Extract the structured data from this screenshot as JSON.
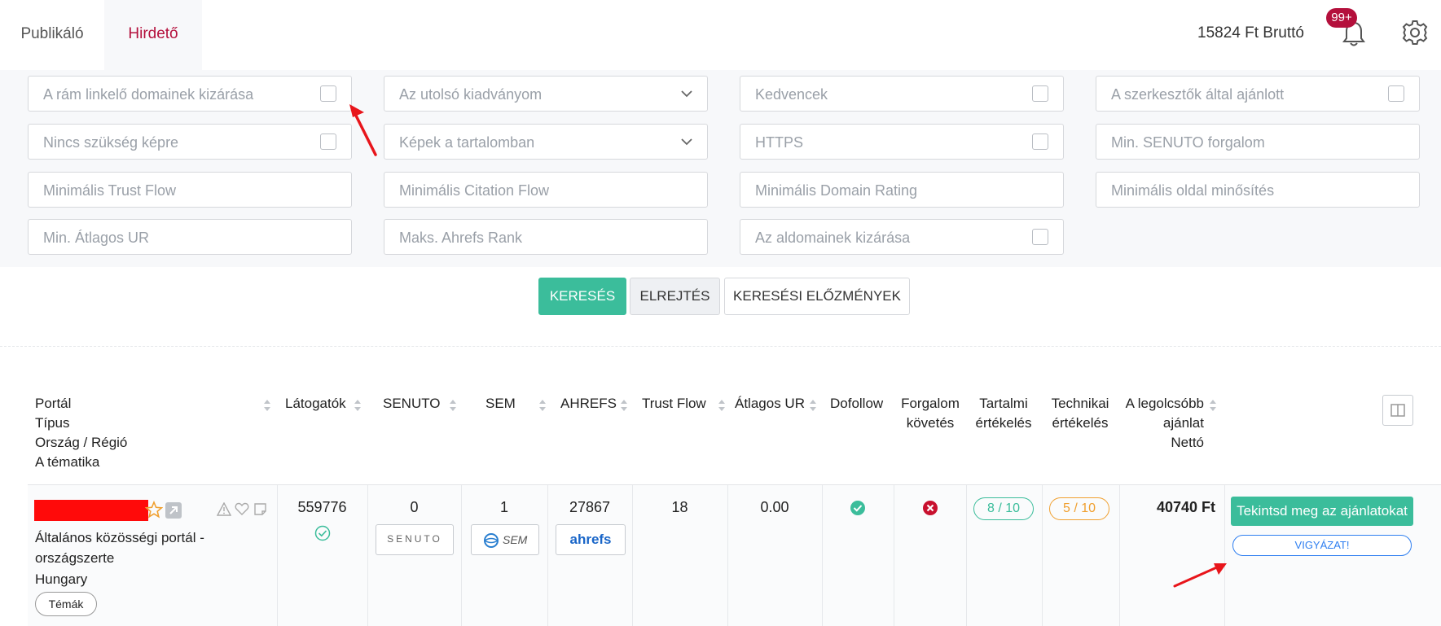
{
  "nav": {
    "tabs": [
      {
        "label": "Publikáló"
      },
      {
        "label": "Hirdető"
      }
    ],
    "balance": "15824 Ft Bruttó",
    "notifications_badge": "99+"
  },
  "filters": {
    "exclude_linking_domains": "A rám linkelő domainek kizárása",
    "last_publication": "Az utolsó kiadványom",
    "favorites": "Kedvencek",
    "editor_recommended": "A szerkesztők által ajánlott",
    "no_image_needed": "Nincs szükség képre",
    "images_in_content": "Képek a tartalomban",
    "https": "HTTPS",
    "min_senuto": "Min. SENUTO forgalom",
    "min_trust_flow": "Minimális Trust Flow",
    "min_citation_flow": "Minimális Citation Flow",
    "min_domain_rating": "Minimális Domain Rating",
    "min_page_rating": "Minimális oldal minősítés",
    "min_avg_ur": "Min. Átlagos UR",
    "max_ahrefs_rank": "Maks. Ahrefs Rank",
    "exclude_subdomains": "Az aldomainek kizárása"
  },
  "actions": {
    "search": "KERESÉS",
    "hide": "ELREJTÉS",
    "history": "KERESÉSI ELŐZMÉNYEK"
  },
  "table": {
    "headers": {
      "portal": "Portál",
      "type": "Típus",
      "country_region": "Ország / Régió",
      "topic": "A tématika",
      "visitors": "Látogatók",
      "senuto": "SENUTO",
      "sem": "SEM",
      "ahrefs": "AHREFS",
      "trust_flow": "Trust Flow",
      "avg_ur": "Átlagos UR",
      "dofollow": "Dofollow",
      "traffic_1": "Forgalom",
      "traffic_2": "követés",
      "content_1": "Tartalmi",
      "content_2": "értékelés",
      "tech_1": "Technikai",
      "tech_2": "értékelés",
      "price_1": "A legolcsóbb",
      "price_2": "ajánlat",
      "price_3": "Nettó"
    },
    "rows": [
      {
        "type_line1": "Általános közösségi portál -",
        "type_line2": "országszerte",
        "country": "Hungary",
        "topics_button": "Témák",
        "visitors": "559776",
        "senuto": "0",
        "senuto_logo": "SENUTO",
        "sem": "1",
        "sem_logo": "SEM",
        "ahrefs": "27867",
        "ahrefs_logo": "ahrefs",
        "trust_flow": "18",
        "avg_ur": "0.00",
        "content_rating": "8 / 10",
        "tech_rating": "5 / 10",
        "price": "40740 Ft",
        "offers_button": "Tekintsd meg az ajánlatokat",
        "warning_button": "VIGYÁZAT!"
      }
    ]
  },
  "colors": {
    "accent": "#b4103c",
    "primary_green": "#3bbd9b",
    "annotation_red": "#e8151b",
    "warning_blue": "#2f7ff0",
    "rating_green": "#3bbd9b",
    "rating_orange": "#f0a030"
  },
  "icons": [
    "bell-icon",
    "gear-icon",
    "checkbox",
    "chevron-down-icon",
    "sort-icon",
    "star-icon",
    "external-link-icon",
    "warning-icon",
    "heart-icon",
    "note-icon",
    "check-circle-icon",
    "x-circle-icon",
    "columns-icon"
  ]
}
